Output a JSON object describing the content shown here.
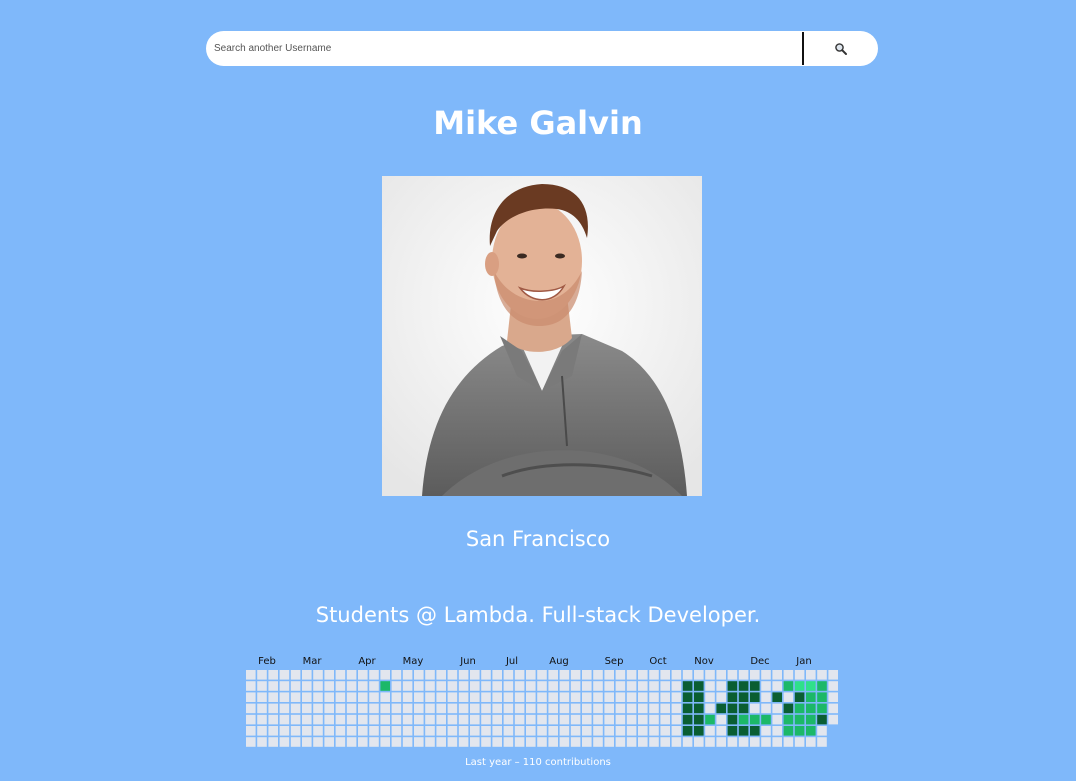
{
  "search": {
    "placeholder": "Search another Username",
    "button_icon": "search-icon"
  },
  "profile": {
    "name": "Mike Galvin",
    "location": "San Francisco",
    "bio": "Students @ Lambda. Full-stack Developer."
  },
  "contributions": {
    "months": [
      "Feb",
      "Mar",
      "Apr",
      "May",
      "Jun",
      "Jul",
      "Aug",
      "Sep",
      "Oct",
      "Nov",
      "Dec",
      "Jan"
    ],
    "summary": "Last year – 110 contributions",
    "total": 110,
    "colors": {
      "empty": "#e2e6ee",
      "level1": "#2fe08a",
      "level2": "#1cb868",
      "level3": "#0f8a4c",
      "level4": "#0a5e32"
    }
  }
}
